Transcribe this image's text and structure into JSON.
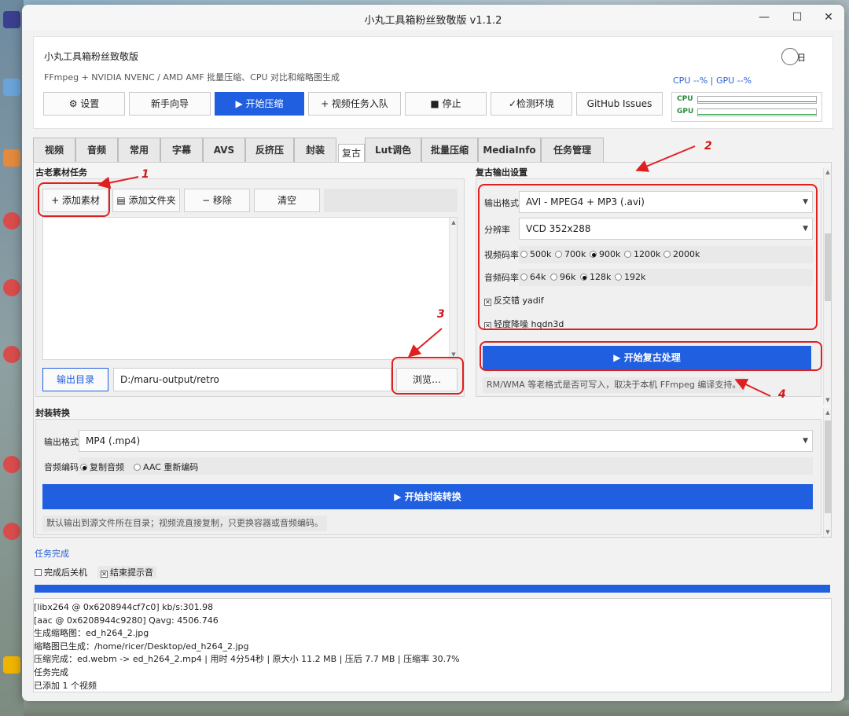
{
  "window": {
    "title": "小丸工具箱粉丝致敬版 v1.1.2",
    "minimize_glyph": "—",
    "maximize_glyph": "☐",
    "close_glyph": "✕"
  },
  "header": {
    "app_name": "小丸工具箱粉丝致敬版",
    "subtitle": "FFmpeg + NVIDIA NVENC / AMD AMF 批量压缩、CPU 对比和缩略图生成",
    "theme_label": "日",
    "cpu_gpu_text": "CPU --% | GPU --%",
    "meter_cpu": "CPU",
    "meter_gpu": "GPU",
    "toolbar": {
      "settings": "⚙ 设置",
      "guide": "新手向导",
      "start": "▶ 开始压缩",
      "enqueue": "+ 视频任务入队",
      "stop": "■ 停止",
      "check_env": "✓检测环境",
      "github": "GitHub Issues"
    }
  },
  "tabs": [
    "视频",
    "音频",
    "常用",
    "字幕",
    "AVS",
    "反挤压",
    "封装",
    "复古",
    "Lut调色",
    "批量压缩",
    "MediaInfo",
    "任务管理"
  ],
  "active_tab": "复古",
  "retro": {
    "source_title": "古老素材任务",
    "add_material": "+ 添加素材",
    "add_folder": "▤ 添加文件夹",
    "remove": "− 移除",
    "clear": "清空",
    "output_dir_button": "输出目录",
    "output_dir_value": "D:/maru-output/retro",
    "browse": "浏览…",
    "settings_title": "复古输出设置",
    "format_label": "输出格式",
    "format_value": "AVI - MPEG4 + MP3 (.avi)",
    "resolution_label": "分辨率",
    "resolution_value": "VCD 352x288",
    "vbitrate_label": "视频码率",
    "vbitrate_options": [
      "500k",
      "700k",
      "900k",
      "1200k",
      "2000k"
    ],
    "vbitrate_selected": "900k",
    "abitrate_label": "音频码率",
    "abitrate_options": [
      "64k",
      "96k",
      "128k",
      "192k"
    ],
    "abitrate_selected": "128k",
    "deinterlace": "反交错 yadif",
    "denoise": "轻度降噪 hqdn3d",
    "start_button": "▶ 开始复古处理",
    "note": "RM/WMA 等老格式是否可写入，取决于本机 FFmpeg 编译支持。"
  },
  "remux": {
    "title": "封装转换",
    "format_label": "输出格式",
    "format_value": "MP4 (.mp4)",
    "audio_label": "音频编码",
    "audio_copy": "复制音频",
    "audio_aac": "AAC 重新编码",
    "start_button": "▶ 开始封装转换",
    "note": "默认输出到源文件所在目录；视频流直接复制，只更换容器或音频编码。"
  },
  "status": {
    "text": "任务完成",
    "shutdown": "完成后关机",
    "beep": "结束提示音",
    "progress_fraction": 1.0
  },
  "log": [
    "[libx264 @ 0x6208944cf7c0] kb/s:301.98",
    "[aac @ 0x6208944c9280] Qavg: 4506.746",
    "生成缩略图：ed_h264_2.jpg",
    "缩略图已生成：/home/ricer/Desktop/ed_h264_2.jpg",
    "压缩完成：ed.webm -> ed_h264_2.mp4 | 用时 4分54秒 | 原大小 11.2 MB | 压后 7.7 MB | 压缩率 30.7%",
    "任务完成",
    "已添加 1 个视频"
  ],
  "annotations": [
    "1",
    "2",
    "3",
    "4"
  ],
  "colors": {
    "accent": "#1f5fe0",
    "annotation": "#e02020"
  }
}
